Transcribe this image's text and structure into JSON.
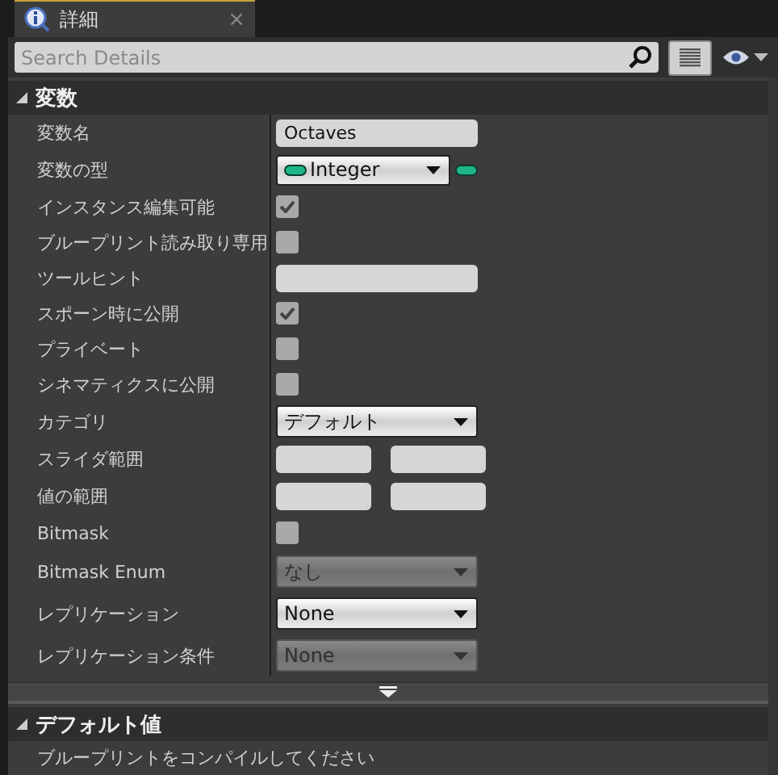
{
  "tab": {
    "title": "詳細",
    "close": "×"
  },
  "search": {
    "placeholder": "Search Details"
  },
  "sections": [
    {
      "title": "変数",
      "expanded": true,
      "rows": [
        {
          "label": "変数名",
          "kind": "text",
          "value": "Octaves"
        },
        {
          "label": "変数の型",
          "kind": "type",
          "value": "Integer"
        },
        {
          "label": "インスタンス編集可能",
          "kind": "check",
          "checked": true
        },
        {
          "label": "ブループリント読み取り専用",
          "kind": "check",
          "checked": false
        },
        {
          "label": "ツールヒント",
          "kind": "text",
          "value": ""
        },
        {
          "label": "スポーン時に公開",
          "kind": "check",
          "checked": true
        },
        {
          "label": "プライベート",
          "kind": "check",
          "checked": false
        },
        {
          "label": "シネマティクスに公開",
          "kind": "check",
          "checked": false
        },
        {
          "label": "カテゴリ",
          "kind": "combo",
          "value": "デフォルト",
          "disabled": false
        },
        {
          "label": "スライダ範囲",
          "kind": "range"
        },
        {
          "label": "値の範囲",
          "kind": "range"
        },
        {
          "label": "Bitmask",
          "kind": "check",
          "checked": false
        },
        {
          "label": "Bitmask Enum",
          "kind": "select",
          "value": "なし",
          "disabled": true
        },
        {
          "label": "レプリケーション",
          "kind": "select",
          "value": "None",
          "disabled": false
        },
        {
          "label": "レプリケーション条件",
          "kind": "select",
          "value": "None",
          "disabled": true
        }
      ],
      "more": true
    },
    {
      "title": "デフォルト値",
      "expanded": true,
      "message": "ブループリントをコンパイルしてください"
    }
  ]
}
